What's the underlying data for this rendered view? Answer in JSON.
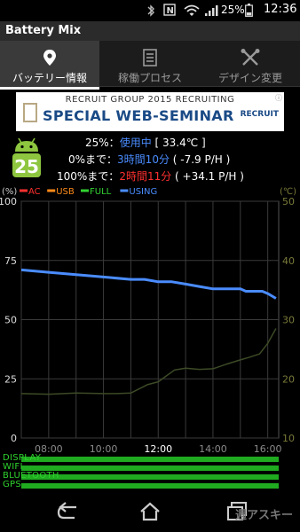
{
  "status_bar": {
    "battery_percent": "25%",
    "time": "12:36"
  },
  "app": {
    "title": "Battery Mix"
  },
  "tabs": [
    {
      "label": "バッテリー情報",
      "icon": "location-pin-icon",
      "active": true
    },
    {
      "label": "稼働プロセス",
      "icon": "list-icon",
      "active": false
    },
    {
      "label": "デザイン変更",
      "icon": "tools-icon",
      "active": false
    }
  ],
  "ad": {
    "top_line": "RECRUIT GROUP 2015 RECRUITING",
    "main_line": "SPECIAL WEB-SEMINAR",
    "logo": "RECRUIT"
  },
  "battery": {
    "level": "25",
    "line1_prefix": "25%：",
    "line1_status": "使用中",
    "line1_temp": " [ 33.4℃ ]",
    "line2_prefix": "0%まで：",
    "line2_time": "3時間10分",
    "line2_rate": " ( -7.9 P/H )",
    "line3_prefix": "100%まで：",
    "line3_time": "2時間11分",
    "line3_rate": " ( +34.1 P/H )"
  },
  "chart_data": {
    "type": "line",
    "left_axis_unit": "(%)",
    "right_axis_unit": "(℃)",
    "legend": [
      {
        "name": "AC",
        "color": "#ff3030"
      },
      {
        "name": "USB",
        "color": "#ff8a1a"
      },
      {
        "name": "FULL",
        "color": "#32d232"
      },
      {
        "name": "USING",
        "color": "#4a8cff"
      }
    ],
    "x_ticks": [
      "08:00",
      "10:00",
      "12:00",
      "14:00",
      "16:00"
    ],
    "x_range": [
      7.0,
      16.4
    ],
    "y_left_ticks": [
      0,
      25,
      50,
      75,
      100
    ],
    "y_left_range": [
      0,
      100
    ],
    "y_right_ticks": [
      10,
      20,
      30,
      40,
      50
    ],
    "y_right_range": [
      10,
      50
    ],
    "series": [
      {
        "name": "USING",
        "axis": "left",
        "color": "#4a8cff",
        "x": [
          7.0,
          8.0,
          9.0,
          10.0,
          11.0,
          11.5,
          12.0,
          12.5,
          13.0,
          13.5,
          14.0,
          14.5,
          15.0,
          15.2,
          15.5,
          15.8,
          16.0,
          16.3
        ],
        "y": [
          71,
          70,
          69,
          68,
          67,
          67,
          66,
          66,
          65,
          64,
          63,
          63,
          63,
          62,
          62,
          62,
          61,
          59
        ]
      },
      {
        "axis": "right",
        "color": "#3c4a26",
        "x": [
          7.0,
          8.0,
          9.0,
          10.0,
          10.5,
          11.0,
          11.3,
          11.6,
          12.0,
          12.3,
          12.6,
          13.0,
          13.5,
          14.0,
          14.5,
          15.0,
          15.3,
          15.7,
          16.0,
          16.3
        ],
        "y": [
          17.5,
          17.4,
          17.6,
          17.5,
          17.5,
          17.6,
          18.3,
          19.0,
          19.5,
          20.5,
          21.5,
          21.8,
          21.6,
          21.7,
          22.5,
          23.2,
          23.6,
          24.2,
          26.0,
          28.5
        ]
      }
    ]
  },
  "usage_bars": [
    {
      "label": "DISPLAY"
    },
    {
      "label": "WIFI"
    },
    {
      "label": "BLUETOOTH"
    },
    {
      "label": "GPS"
    }
  ],
  "nav": {
    "watermark": "週アスキー"
  }
}
